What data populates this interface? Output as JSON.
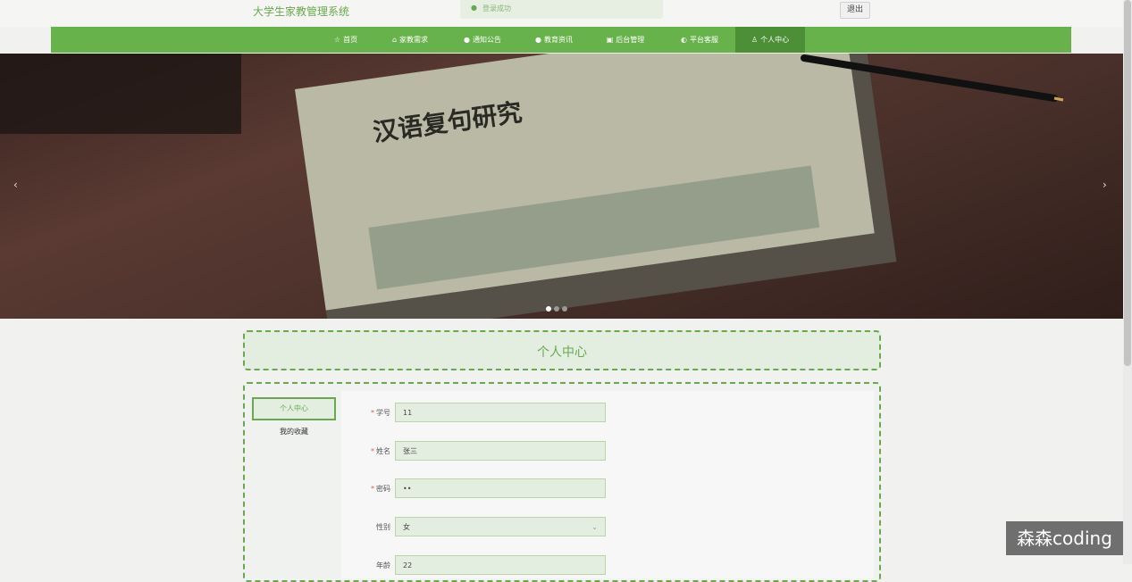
{
  "header": {
    "site_title": "大学生家教管理系统",
    "toast_text": "登录成功",
    "logout_label": "退出"
  },
  "nav": {
    "items": [
      {
        "label": "首页",
        "icon": "☆"
      },
      {
        "label": "家教需求",
        "icon": "⌂"
      },
      {
        "label": "通知公告",
        "icon": "●"
      },
      {
        "label": "教育资讯",
        "icon": "●"
      },
      {
        "label": "后台管理",
        "icon": "▣"
      },
      {
        "label": "平台客服",
        "icon": "◐"
      },
      {
        "label": "个人中心",
        "icon": "♙"
      }
    ]
  },
  "banner": {
    "prev": "‹",
    "next": "›",
    "slides": 3,
    "current_slide": 1,
    "book_title": "汉语复句研究"
  },
  "page": {
    "title": "个人中心"
  },
  "sidebar": {
    "items": [
      {
        "label": "个人中心"
      },
      {
        "label": "我的收藏"
      }
    ]
  },
  "form": {
    "fields": [
      {
        "label": "学号",
        "value": "11",
        "required": true
      },
      {
        "label": "姓名",
        "value": "张三",
        "required": true
      },
      {
        "label": "密码",
        "value": "••",
        "required": true
      },
      {
        "label": "性别",
        "value": "女",
        "required": false
      },
      {
        "label": "年龄",
        "value": "22",
        "required": false
      }
    ]
  },
  "overlay": {
    "watermark": "森森coding"
  }
}
